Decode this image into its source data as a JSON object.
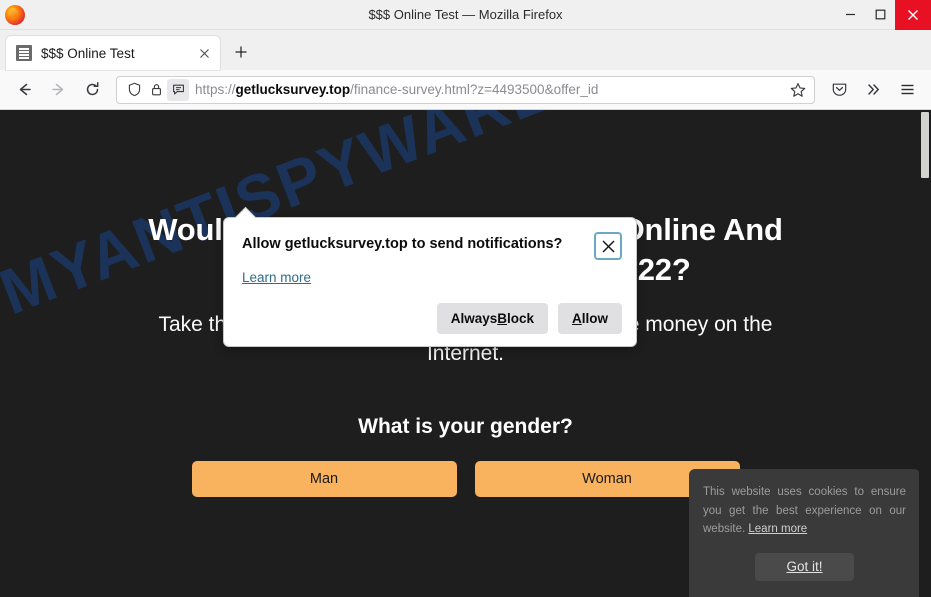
{
  "window": {
    "title": "$$$ Online Test — Mozilla Firefox",
    "minimize_label": "Minimize",
    "maximize_label": "Maximize",
    "close_label": "Close"
  },
  "tabs": {
    "items": [
      {
        "title": "$$$ Online Test",
        "favicon": "document-list-icon",
        "close_label": "Close tab"
      }
    ],
    "new_tab_label": "New tab"
  },
  "toolbar": {
    "back_label": "Go back one page",
    "forward_label": "Go forward one page",
    "reload_label": "Reload current page",
    "shield_label": "Enhanced Tracking Protection",
    "lock_label": "Site information",
    "permission_label": "Notification permission requested",
    "bookmark_label": "Bookmark this page",
    "pocket_label": "Save to Pocket",
    "overflow_label": "More tools",
    "menu_label": "Open application menu",
    "url": {
      "scheme": "https://",
      "host": "getlucksurvey.top",
      "path": "/finance-survey.html?z=4493500&offer_id",
      "full": "https://getlucksurvey.top/finance-survey.html?z=4493500&offer_id="
    }
  },
  "doorhanger": {
    "title": "Allow getlucksurvey.top to send notifications?",
    "learn_more": "Learn more",
    "close_label": "Close",
    "buttons": [
      {
        "label_before": "Always ",
        "accesskey": "B",
        "label_after": "lock",
        "name": "always-block"
      },
      {
        "label_before": "",
        "accesskey": "A",
        "label_after": "llow",
        "name": "allow"
      }
    ]
  },
  "page": {
    "watermark": "MYANTISPYWARE.COM",
    "headline": "Would You Make A Great Career Online And Become A Millionaire By 2022?",
    "subhead": "Take this FREE test and find out how you can make money on the Internet.",
    "question": "What is your gender?",
    "answers": [
      {
        "label": "Man"
      },
      {
        "label": "Woman"
      }
    ],
    "accent_color": "#f9b25e",
    "background_color": "#1e1e1e"
  },
  "cookie_banner": {
    "text": "This website uses cookies to ensure you get the best experience on our website. ",
    "link": "Learn more",
    "button": "Got it!"
  }
}
